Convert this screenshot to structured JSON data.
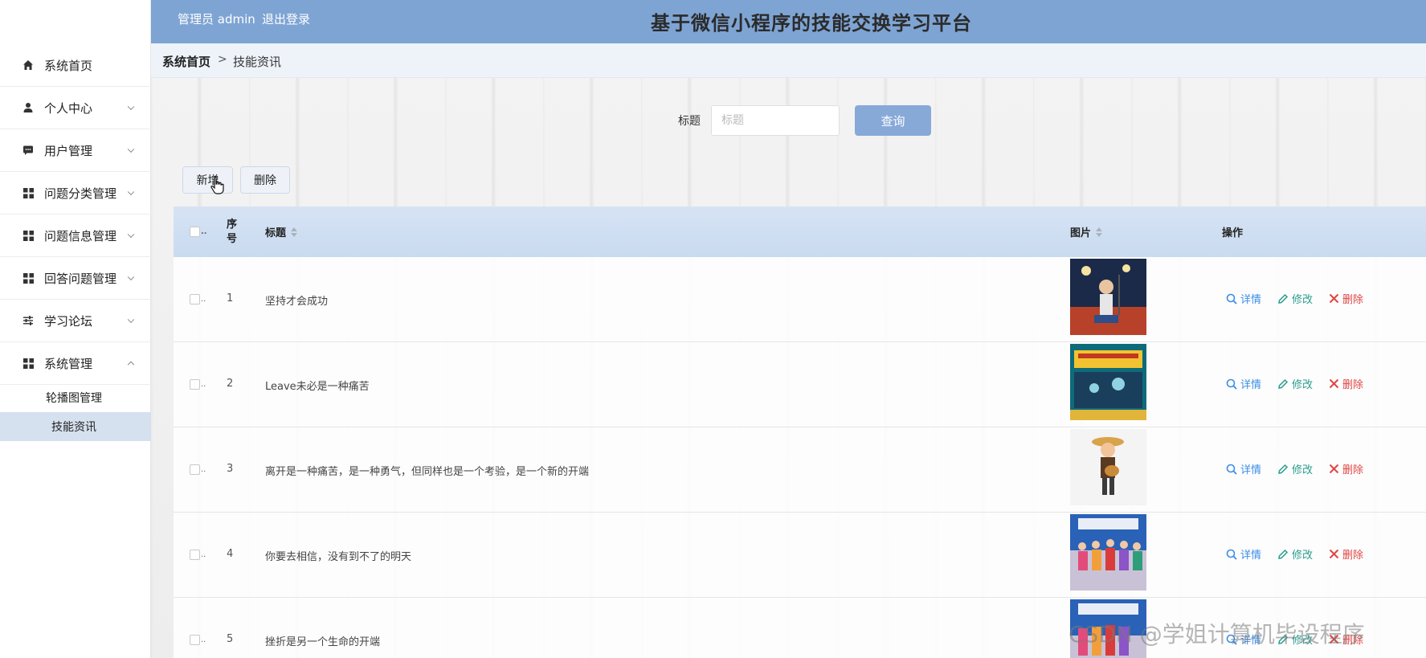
{
  "header": {
    "admin_label": "管理员 admin",
    "logout_label": "退出登录",
    "site_title": "基于微信小程序的技能交换学习平台"
  },
  "sidebar": {
    "items": [
      {
        "label": "系统首页",
        "icon": "home-icon",
        "has_arrow": false
      },
      {
        "label": "个人中心",
        "icon": "user-icon",
        "has_arrow": true
      },
      {
        "label": "用户管理",
        "icon": "chat-icon",
        "has_arrow": true
      },
      {
        "label": "问题分类管理",
        "icon": "grid-icon",
        "has_arrow": true
      },
      {
        "label": "问题信息管理",
        "icon": "grid-icon",
        "has_arrow": true
      },
      {
        "label": "回答问题管理",
        "icon": "grid-icon",
        "has_arrow": true
      },
      {
        "label": "学习论坛",
        "icon": "sliders-icon",
        "has_arrow": true
      },
      {
        "label": "系统管理",
        "icon": "grid-icon",
        "has_arrow": true,
        "expanded": true
      }
    ],
    "sub_items": [
      {
        "label": "轮播图管理",
        "active": false
      },
      {
        "label": "技能资讯",
        "active": true
      }
    ]
  },
  "breadcrumb": {
    "home": "系统首页",
    "separator": ">",
    "current": "技能资讯"
  },
  "search": {
    "label": "标题",
    "placeholder": "标题",
    "value": "",
    "button": "查询"
  },
  "actions": {
    "add": "新增",
    "delete": "删除"
  },
  "table": {
    "columns": {
      "index": "序号",
      "title": "标题",
      "image": "图片",
      "ops": "操作"
    },
    "rows": [
      {
        "no": "1",
        "title": "坚持才会成功"
      },
      {
        "no": "2",
        "title": "Leave未必是一种痛苦"
      },
      {
        "no": "3",
        "title": "离开是一种痛苦，是一种勇气，但同样也是一个考验，是一个新的开端"
      },
      {
        "no": "4",
        "title": "你要去相信，没有到不了的明天"
      },
      {
        "no": "5",
        "title": "挫折是另一个生命的开端"
      }
    ],
    "ops": {
      "view": "详情",
      "edit": "修改",
      "delete": "删除"
    }
  },
  "watermark": "CSDN @学姐计算机毕设程序",
  "colors": {
    "header_bg": "#7ea4d3",
    "query_btn": "#87a9d8",
    "active_sub_bg": "#d6e1ef",
    "op_view": "#3a8ee6",
    "op_edit": "#2a9d8f",
    "op_delete": "#e04545"
  }
}
